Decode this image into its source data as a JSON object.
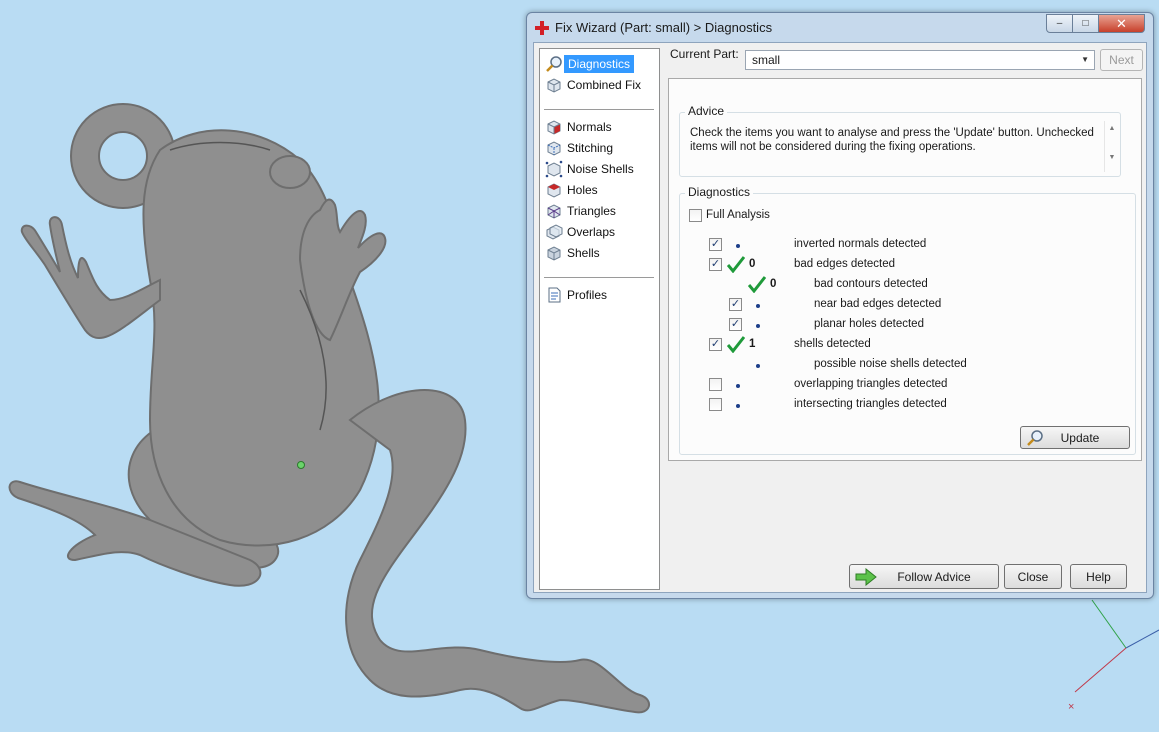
{
  "window": {
    "title": "Fix Wizard (Part: small) > Diagnostics",
    "min_glyph": "–",
    "max_glyph": "□",
    "close_glyph": "✕"
  },
  "nav": {
    "items": [
      {
        "label": "Diagnostics",
        "icon": "magnifier-icon",
        "selected": true
      },
      {
        "label": "Combined Fix",
        "icon": "cube-icon"
      },
      {
        "label": "Normals",
        "icon": "red-cube-icon"
      },
      {
        "label": "Stitching",
        "icon": "stitch-cube-icon"
      },
      {
        "label": "Noise Shells",
        "icon": "noise-cube-icon"
      },
      {
        "label": "Holes",
        "icon": "holes-cube-icon"
      },
      {
        "label": "Triangles",
        "icon": "triangle-cube-icon"
      },
      {
        "label": "Overlaps",
        "icon": "overlap-cube-icon"
      },
      {
        "label": "Shells",
        "icon": "shells-cube-icon"
      },
      {
        "label": "Profiles",
        "icon": "document-icon"
      }
    ]
  },
  "current_part": {
    "label": "Current Part:",
    "value": "small",
    "next_label": "Next"
  },
  "advice": {
    "title": "Advice",
    "text": "Check the items you want to analyse and press the 'Update' button. Unchecked items will not be considered during the fixing operations."
  },
  "diagnostics": {
    "title": "Diagnostics",
    "full_analysis_label": "Full Analysis",
    "full_analysis_checked": false,
    "rows": [
      {
        "label": "inverted normals detected",
        "checked": true,
        "status": "dot",
        "count": ""
      },
      {
        "label": "bad edges detected",
        "checked": true,
        "status": "ok",
        "count": "0"
      },
      {
        "label": "bad contours detected",
        "checked": null,
        "status": "ok",
        "count": "0"
      },
      {
        "label": "near bad edges detected",
        "checked": true,
        "status": "dot",
        "count": ""
      },
      {
        "label": "planar holes detected",
        "checked": true,
        "status": "dot",
        "count": ""
      },
      {
        "label": "shells detected",
        "checked": true,
        "status": "ok",
        "count": "1"
      },
      {
        "label": "possible noise shells detected",
        "checked": null,
        "status": "dot",
        "count": ""
      },
      {
        "label": "overlapping triangles detected",
        "checked": false,
        "status": "dot",
        "count": ""
      },
      {
        "label": "intersecting triangles detected",
        "checked": false,
        "status": "dot",
        "count": ""
      }
    ],
    "update_label": "Update"
  },
  "footer": {
    "follow_label": "Follow Advice",
    "close_label": "Close",
    "help_label": "Help"
  },
  "colors": {
    "background": "#b9dcf3",
    "check_green": "#1f9a3a",
    "selection_blue": "#3399ff"
  }
}
